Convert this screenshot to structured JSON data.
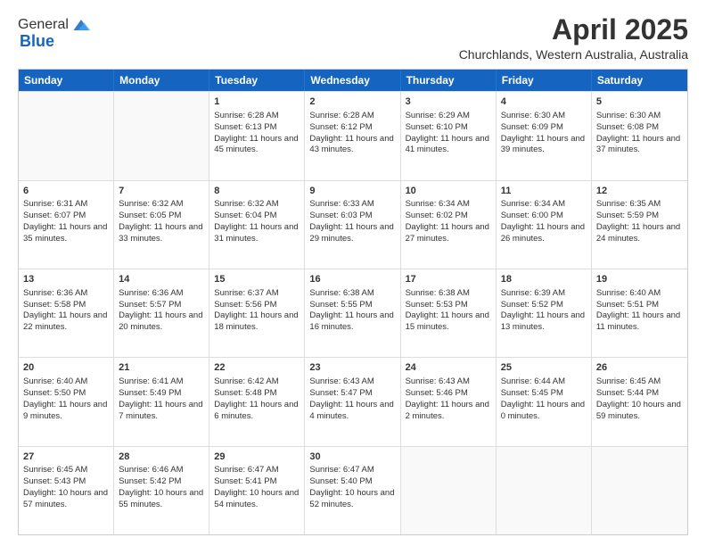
{
  "logo": {
    "general": "General",
    "blue": "Blue"
  },
  "title": "April 2025",
  "subtitle": "Churchlands, Western Australia, Australia",
  "days": [
    "Sunday",
    "Monday",
    "Tuesday",
    "Wednesday",
    "Thursday",
    "Friday",
    "Saturday"
  ],
  "weeks": [
    [
      {
        "day": "",
        "data": ""
      },
      {
        "day": "",
        "data": ""
      },
      {
        "day": "1",
        "data": "Sunrise: 6:28 AM\nSunset: 6:13 PM\nDaylight: 11 hours and 45 minutes."
      },
      {
        "day": "2",
        "data": "Sunrise: 6:28 AM\nSunset: 6:12 PM\nDaylight: 11 hours and 43 minutes."
      },
      {
        "day": "3",
        "data": "Sunrise: 6:29 AM\nSunset: 6:10 PM\nDaylight: 11 hours and 41 minutes."
      },
      {
        "day": "4",
        "data": "Sunrise: 6:30 AM\nSunset: 6:09 PM\nDaylight: 11 hours and 39 minutes."
      },
      {
        "day": "5",
        "data": "Sunrise: 6:30 AM\nSunset: 6:08 PM\nDaylight: 11 hours and 37 minutes."
      }
    ],
    [
      {
        "day": "6",
        "data": "Sunrise: 6:31 AM\nSunset: 6:07 PM\nDaylight: 11 hours and 35 minutes."
      },
      {
        "day": "7",
        "data": "Sunrise: 6:32 AM\nSunset: 6:05 PM\nDaylight: 11 hours and 33 minutes."
      },
      {
        "day": "8",
        "data": "Sunrise: 6:32 AM\nSunset: 6:04 PM\nDaylight: 11 hours and 31 minutes."
      },
      {
        "day": "9",
        "data": "Sunrise: 6:33 AM\nSunset: 6:03 PM\nDaylight: 11 hours and 29 minutes."
      },
      {
        "day": "10",
        "data": "Sunrise: 6:34 AM\nSunset: 6:02 PM\nDaylight: 11 hours and 27 minutes."
      },
      {
        "day": "11",
        "data": "Sunrise: 6:34 AM\nSunset: 6:00 PM\nDaylight: 11 hours and 26 minutes."
      },
      {
        "day": "12",
        "data": "Sunrise: 6:35 AM\nSunset: 5:59 PM\nDaylight: 11 hours and 24 minutes."
      }
    ],
    [
      {
        "day": "13",
        "data": "Sunrise: 6:36 AM\nSunset: 5:58 PM\nDaylight: 11 hours and 22 minutes."
      },
      {
        "day": "14",
        "data": "Sunrise: 6:36 AM\nSunset: 5:57 PM\nDaylight: 11 hours and 20 minutes."
      },
      {
        "day": "15",
        "data": "Sunrise: 6:37 AM\nSunset: 5:56 PM\nDaylight: 11 hours and 18 minutes."
      },
      {
        "day": "16",
        "data": "Sunrise: 6:38 AM\nSunset: 5:55 PM\nDaylight: 11 hours and 16 minutes."
      },
      {
        "day": "17",
        "data": "Sunrise: 6:38 AM\nSunset: 5:53 PM\nDaylight: 11 hours and 15 minutes."
      },
      {
        "day": "18",
        "data": "Sunrise: 6:39 AM\nSunset: 5:52 PM\nDaylight: 11 hours and 13 minutes."
      },
      {
        "day": "19",
        "data": "Sunrise: 6:40 AM\nSunset: 5:51 PM\nDaylight: 11 hours and 11 minutes."
      }
    ],
    [
      {
        "day": "20",
        "data": "Sunrise: 6:40 AM\nSunset: 5:50 PM\nDaylight: 11 hours and 9 minutes."
      },
      {
        "day": "21",
        "data": "Sunrise: 6:41 AM\nSunset: 5:49 PM\nDaylight: 11 hours and 7 minutes."
      },
      {
        "day": "22",
        "data": "Sunrise: 6:42 AM\nSunset: 5:48 PM\nDaylight: 11 hours and 6 minutes."
      },
      {
        "day": "23",
        "data": "Sunrise: 6:43 AM\nSunset: 5:47 PM\nDaylight: 11 hours and 4 minutes."
      },
      {
        "day": "24",
        "data": "Sunrise: 6:43 AM\nSunset: 5:46 PM\nDaylight: 11 hours and 2 minutes."
      },
      {
        "day": "25",
        "data": "Sunrise: 6:44 AM\nSunset: 5:45 PM\nDaylight: 11 hours and 0 minutes."
      },
      {
        "day": "26",
        "data": "Sunrise: 6:45 AM\nSunset: 5:44 PM\nDaylight: 10 hours and 59 minutes."
      }
    ],
    [
      {
        "day": "27",
        "data": "Sunrise: 6:45 AM\nSunset: 5:43 PM\nDaylight: 10 hours and 57 minutes."
      },
      {
        "day": "28",
        "data": "Sunrise: 6:46 AM\nSunset: 5:42 PM\nDaylight: 10 hours and 55 minutes."
      },
      {
        "day": "29",
        "data": "Sunrise: 6:47 AM\nSunset: 5:41 PM\nDaylight: 10 hours and 54 minutes."
      },
      {
        "day": "30",
        "data": "Sunrise: 6:47 AM\nSunset: 5:40 PM\nDaylight: 10 hours and 52 minutes."
      },
      {
        "day": "",
        "data": ""
      },
      {
        "day": "",
        "data": ""
      },
      {
        "day": "",
        "data": ""
      }
    ]
  ]
}
